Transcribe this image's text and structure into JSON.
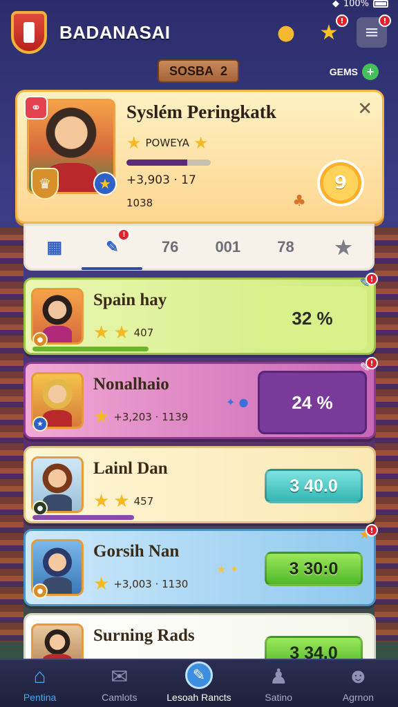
{
  "status": {
    "battery": "100%"
  },
  "header": {
    "title": "BADANASAI",
    "chat_badge": "",
    "star_badge": "!",
    "menu_badge": "!"
  },
  "season": {
    "label": "SOSBA",
    "number": "2"
  },
  "gems": {
    "label": "GEMS"
  },
  "profile": {
    "title": "Syslém Peringkatk",
    "stars_label": "POWEYA",
    "xp_progress": 0.72,
    "score": "+3,903 · 17",
    "level": "1038",
    "badge_value": "9"
  },
  "tabs": [
    {
      "label": "",
      "icon": "grid-icon"
    },
    {
      "label": "",
      "icon": "edit-icon",
      "badge": "!"
    },
    {
      "label": "76"
    },
    {
      "label": "001"
    },
    {
      "label": "78"
    },
    {
      "label": "",
      "icon": "star-icon"
    }
  ],
  "rows": [
    {
      "name": "Spain hay",
      "meta": "407",
      "value": "32 %",
      "progress": 0.8,
      "color": "#cfec7c"
    },
    {
      "name": "Nonalhaio",
      "meta": "+3,203 · 1139",
      "value": "24 %",
      "progress": 0,
      "color": "#c867b6"
    },
    {
      "name": "Lainl Dan",
      "meta": "457",
      "value": "3 40.0",
      "progress": 0.7,
      "color": "#fbe8b4"
    },
    {
      "name": "Gorsih Nan",
      "meta": "+3,003 · 1130",
      "value": "3 30:0",
      "progress": 0,
      "color": "#8fc8ee"
    },
    {
      "name": "Surning Rads",
      "meta": "",
      "value": "3 34.0",
      "progress": 0,
      "color": "#f4f6ea"
    }
  ],
  "nav": [
    {
      "label": "Pentina",
      "icon": "home-icon"
    },
    {
      "label": "Camlots",
      "icon": "mail-icon"
    },
    {
      "label": "Lesoah Rancts",
      "icon": "compass-icon"
    },
    {
      "label": "Satino",
      "icon": "person-icon"
    },
    {
      "label": "Agrnon",
      "icon": "profile-icon"
    }
  ]
}
